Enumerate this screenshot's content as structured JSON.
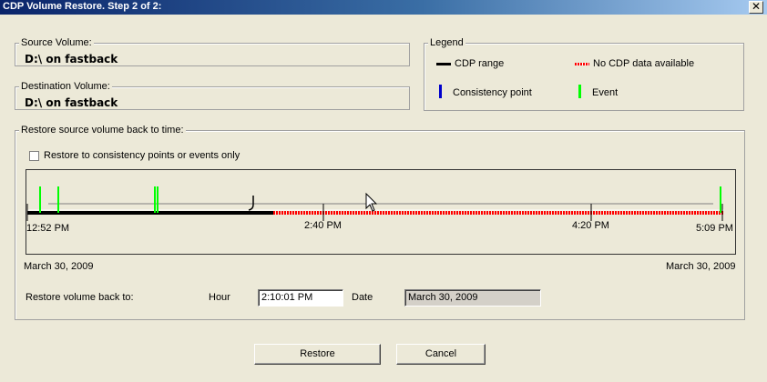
{
  "window": {
    "title": "CDP Volume Restore. Step 2 of 2:",
    "close_glyph": "✕"
  },
  "source": {
    "label": "Source Volume:",
    "value": "D:\\ on fastback"
  },
  "destination": {
    "label": "Destination Volume:",
    "value": "D:\\ on fastback"
  },
  "legend": {
    "title": "Legend",
    "cdp_range": "CDP range",
    "no_cdp": "No CDP data available",
    "consistency_point": "Consistency point",
    "event": "Event",
    "colors": {
      "cdp_range": "#000000",
      "no_cdp": "#ff0000",
      "consistency_point": "#0000cc",
      "event": "#00ff00"
    }
  },
  "restore": {
    "group_label": "Restore source volume back to time:",
    "checkbox_label": "Restore to consistency points or events only",
    "checkbox_checked": false,
    "ticks": [
      "12:52 PM",
      "2:40 PM",
      "4:20 PM",
      "5:09 PM"
    ],
    "start_date": "March 30, 2009",
    "end_date": "March 30, 2009",
    "back_to_label": "Restore volume back to:",
    "hour_label": "Hour",
    "hour_value": "2:10:01 PM",
    "date_label": "Date",
    "date_value": "March 30, 2009"
  },
  "buttons": {
    "restore": "Restore",
    "cancel": "Cancel"
  }
}
